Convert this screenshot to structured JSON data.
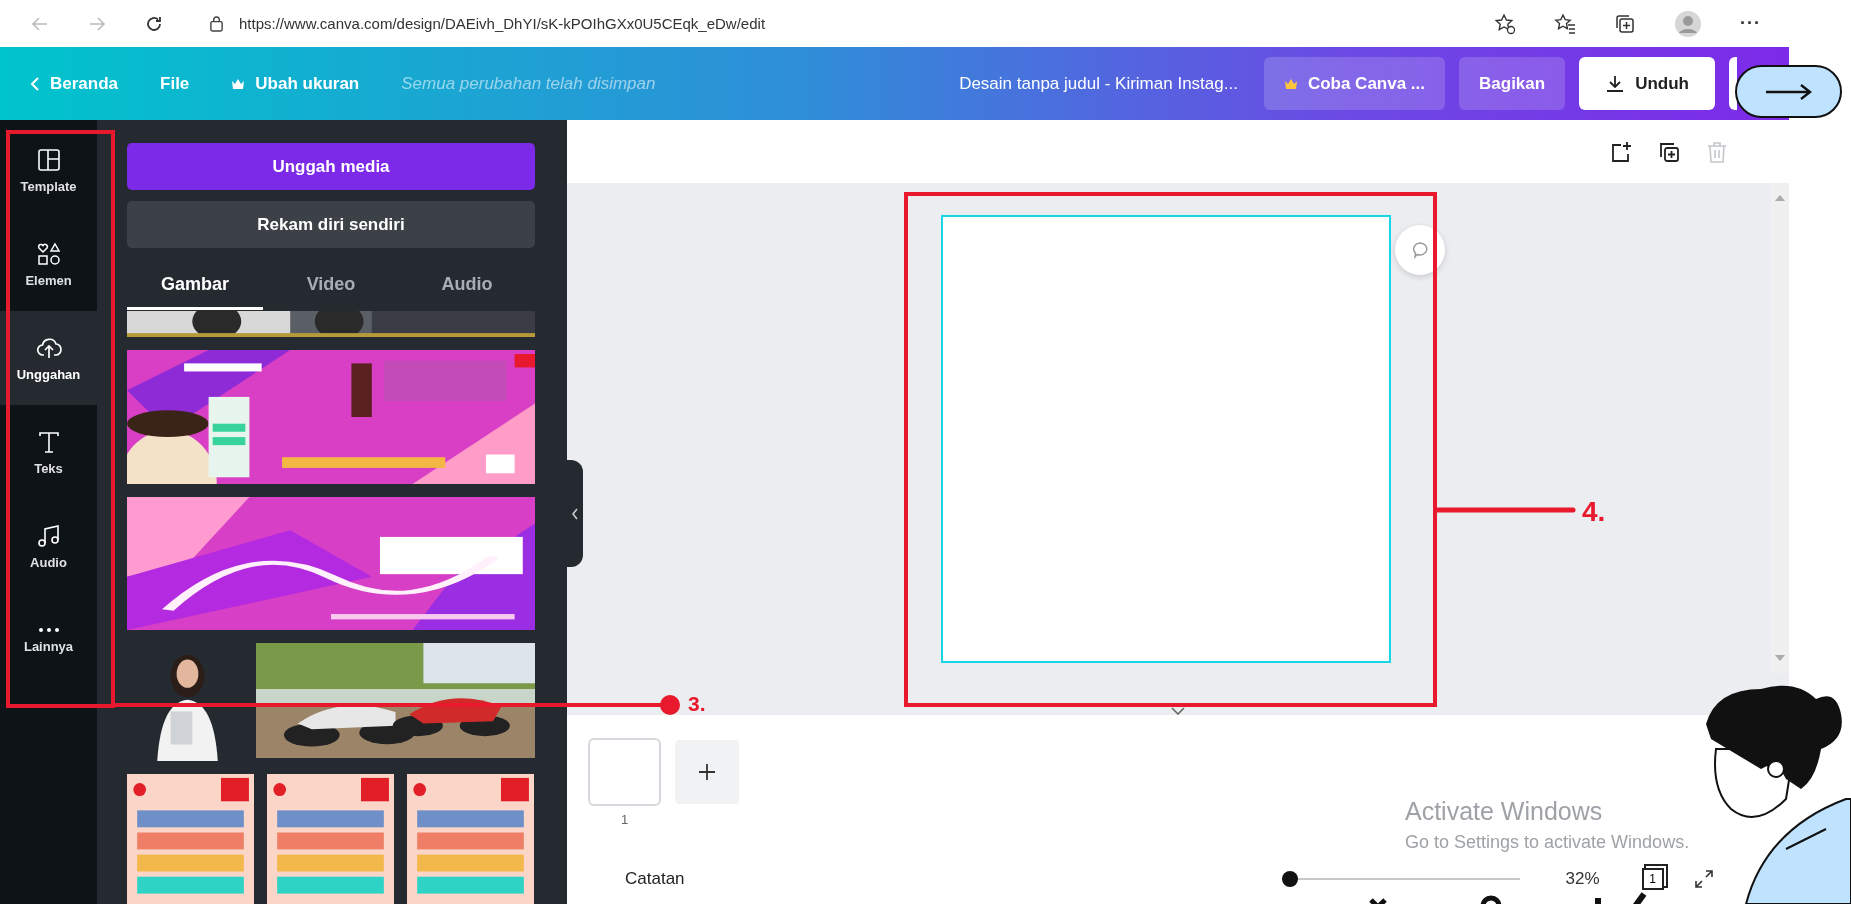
{
  "browser": {
    "nav": [
      {
        "kind": "back",
        "disabled": true
      },
      {
        "kind": "forward",
        "disabled": true
      },
      {
        "kind": "refresh",
        "disabled": false
      }
    ],
    "url": "https://www.canva.com/design/DAEivh_DhYI/sK-kPOIhGXx0U5CEqk_eDw/edit",
    "more": "···"
  },
  "header": {
    "back": "Beranda",
    "file": "File",
    "resize": "Ubah ukuran",
    "status": "Semua perubahan telah disimpan",
    "title": "Desain tanpa judul - Kiriman Instag...",
    "pro": "Coba Canva ...",
    "share": "Bagikan",
    "download": "Unduh"
  },
  "rail": [
    {
      "kind": "template",
      "label": "Template",
      "selected": false
    },
    {
      "kind": "elements",
      "label": "Elemen",
      "selected": false
    },
    {
      "kind": "uploads",
      "label": "Unggahan",
      "selected": true
    },
    {
      "kind": "text",
      "label": "Teks",
      "selected": false
    },
    {
      "kind": "audio",
      "label": "Audio",
      "selected": false
    },
    {
      "kind": "more",
      "label": "Lainnya",
      "selected": false
    }
  ],
  "panel": {
    "buttons": [
      {
        "kind": "primary",
        "label": "Unggah media"
      },
      {
        "kind": "secondary",
        "label": "Rekam diri sendiri"
      }
    ],
    "tabs": [
      {
        "label": "Gambar",
        "selected": true
      },
      {
        "label": "Video",
        "selected": false
      },
      {
        "label": "Audio",
        "selected": false
      }
    ]
  },
  "toolbar": [
    {
      "kind": "add-page",
      "disabled": false
    },
    {
      "kind": "duplicate",
      "disabled": false
    },
    {
      "kind": "delete",
      "disabled": true
    }
  ],
  "pages": [
    {
      "number": "1"
    }
  ],
  "notes": "Catatan",
  "zoom": {
    "level": 0,
    "reading": "32%"
  },
  "page_count": "1",
  "annotations": [
    {
      "number": "3."
    },
    {
      "number": "4."
    }
  ],
  "windows_notice": {
    "title": "Activate Windows",
    "text": "Go to Settings to activate Windows."
  }
}
